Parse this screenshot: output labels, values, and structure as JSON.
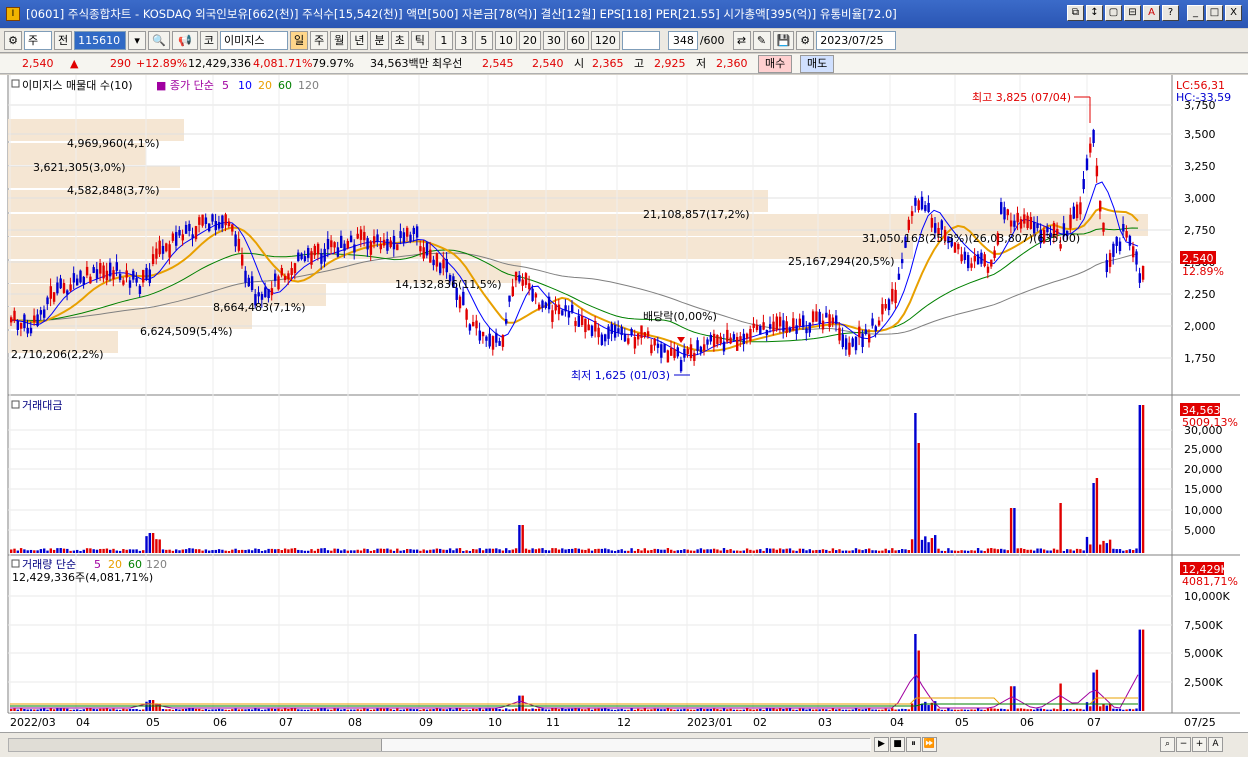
{
  "window": {
    "title": "[0601] 주식종합차트 - KOSDAQ 외국인보유[662(천)] 주식수[15,542(천)] 액면[500] 자본금[78(억)] 결산[12월] EPS[118] PER[21.55] 시가총액[395(억)] 유통비율[72.0]",
    "buttons": [
      "⧉",
      "↕",
      "▢",
      "⊟",
      "A",
      "?",
      "_",
      "□",
      "X"
    ]
  },
  "toolbar": {
    "type": "주",
    "prev": "전",
    "code": "115610",
    "search": "🔍",
    "speaker": "📢",
    "market": "코",
    "stock_name": "이미지스",
    "periods": [
      "일",
      "주",
      "월",
      "년",
      "분",
      "초",
      "틱"
    ],
    "intervals": [
      "1",
      "3",
      "5",
      "10",
      "20",
      "30",
      "60",
      "120"
    ],
    "count": "348",
    "count_total": "/600",
    "date": "2023/07/25"
  },
  "quote": {
    "price": "2,540",
    "change": "290",
    "pct": "+12.89%",
    "volume": "12,429,336",
    "vol_pct": "4,081.71%",
    "ratio": "79.97%",
    "amount": "34,563백만",
    "priority_label": "최우선",
    "ask": "2,545",
    "bid": "2,540",
    "open_label": "시",
    "open": "2,365",
    "high_label": "고",
    "high": "2,925",
    "low_label": "저",
    "low": "2,360",
    "buy": "매수",
    "sell": "매도"
  },
  "price_pane": {
    "legend_title": "이미지스 매물대 수(10)",
    "ma_label": "종가 단순",
    "ma_periods": [
      "5",
      "10",
      "20",
      "60",
      "120"
    ],
    "lc": "LC:56,31",
    "hc": "HC:-33,59",
    "current": "2,540",
    "current_pct": "12.89%",
    "high_note": "최고 3,825 (07/04)",
    "low_note": "최저 1,625 (01/03)",
    "dividend": "배당락(0,00%)",
    "volume_profile": [
      "4,969,960(4,1%)",
      "3,621,305(3,0%)",
      "4,582,848(3,7%)",
      "21,108,857(17,2%)",
      "31,050,163(25,3%)(26,03,807)(635,00)",
      "25,167,294(20,5%)",
      "14,132,836(11,5%)",
      "8,664,483(7,1%)",
      "6,624,509(5,4%)",
      "2,710,206(2,2%)"
    ],
    "yticks": [
      "3,750",
      "3,500",
      "3,250",
      "3,000",
      "2,750",
      "2,500",
      "2,250",
      "2,000",
      "1,750"
    ]
  },
  "amount_pane": {
    "title": "거래대금",
    "current": "34,563",
    "current_pct": "5009,13%",
    "yticks": [
      "30,000",
      "25,000",
      "20,000",
      "15,000",
      "10,000",
      "5,000"
    ]
  },
  "volume_pane": {
    "title": "거래량 단순",
    "ma_periods": [
      "5",
      "20",
      "60",
      "120"
    ],
    "info": "12,429,336주(4,081,71%)",
    "current": "12,429K",
    "current_pct": "4081,71%",
    "yticks": [
      "10,000K",
      "7,500K",
      "5,000K",
      "2,500K"
    ]
  },
  "xaxis": {
    "labels": [
      "2022/03",
      "04",
      "05",
      "06",
      "07",
      "08",
      "09",
      "10",
      "11",
      "12",
      "2023/01",
      "02",
      "03",
      "04",
      "05",
      "06",
      "07"
    ],
    "last": "07/25"
  },
  "colors": {
    "up": "#e00000",
    "down": "#0000d0",
    "ma5": "#a000a0",
    "ma10": "#0000ff",
    "ma20": "#e8a000",
    "ma60": "#008000",
    "ma120": "#808080",
    "profile": "#f5e6d3"
  }
}
